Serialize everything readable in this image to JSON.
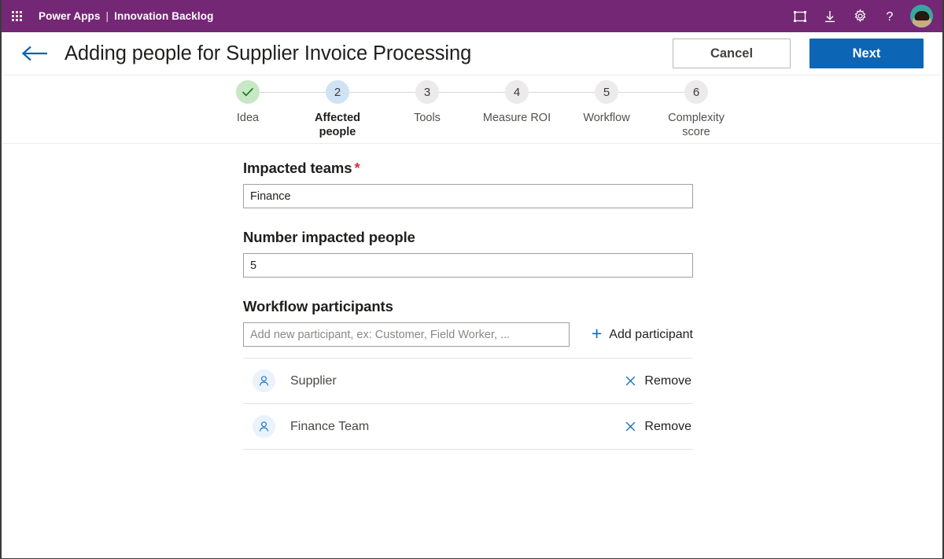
{
  "suitebar": {
    "waffle_label": "App launcher",
    "app_name": "Power Apps",
    "separator": "|",
    "env_name": "Innovation Backlog",
    "icons": [
      {
        "name": "fit-to-screen-icon",
        "glyph": "fit-to-screen"
      },
      {
        "name": "download-icon",
        "glyph": "download"
      },
      {
        "name": "gear-icon",
        "glyph": "gear"
      },
      {
        "name": "help-icon",
        "glyph": "question-mark"
      }
    ],
    "avatar_label": "User account"
  },
  "header": {
    "back_label": "Back",
    "title": "Adding people for Supplier Invoice Processing",
    "cancel_label": "Cancel",
    "next_label": "Next"
  },
  "stepper": {
    "steps": [
      {
        "number": "1",
        "label": "Idea",
        "state": "done",
        "mark": "✓"
      },
      {
        "number": "2",
        "label": "Affected people",
        "state": "active",
        "mark": "2"
      },
      {
        "number": "3",
        "label": "Tools",
        "state": "todo",
        "mark": "3"
      },
      {
        "number": "4",
        "label": "Measure ROI",
        "state": "todo",
        "mark": "4"
      },
      {
        "number": "5",
        "label": "Workflow",
        "state": "todo",
        "mark": "5"
      },
      {
        "number": "6",
        "label": "Complexity score",
        "state": "todo",
        "mark": "6"
      }
    ]
  },
  "form": {
    "impacted_teams": {
      "label": "Impacted teams",
      "required_mark": "*",
      "value": "Finance",
      "placeholder": ""
    },
    "number_impacted_people": {
      "label": "Number impacted people",
      "value": "5",
      "placeholder": ""
    },
    "workflow_participants": {
      "label": "Workflow participants",
      "value": "",
      "placeholder": "Add new participant, ex: Customer, Field Worker, ...",
      "add_button_label": "Add participant",
      "add_button_icon": "plus-icon",
      "remove_label": "Remove",
      "participants": [
        {
          "name": "Supplier"
        },
        {
          "name": "Finance Team"
        }
      ]
    }
  },
  "colors": {
    "suitebar_purple": "#742774",
    "primary_blue": "#0d65b5",
    "link_blue": "#0f6cbd",
    "required_red": "#d13438",
    "step_done_green": "#c7e7c5",
    "step_active_blue": "#cfe3f5",
    "step_todo_gray": "#eceaea"
  }
}
